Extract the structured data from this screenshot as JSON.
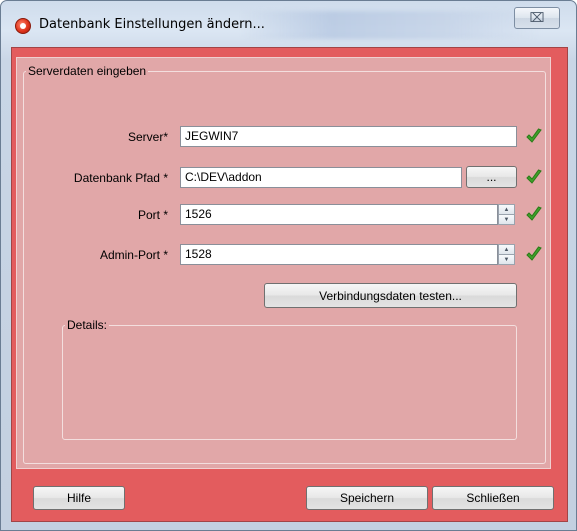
{
  "window": {
    "title": "Datenbank Einstellungen ändern...",
    "close_glyph": "⌧"
  },
  "group_server": {
    "legend": "Serverdaten eingeben"
  },
  "fields": {
    "server_label": "Server*",
    "server_value": "JEGWIN7",
    "path_label": "Datenbank Pfad *",
    "path_value": "C:\\DEV\\addon",
    "browse_label": "...",
    "port_label": "Port *",
    "port_value": "1526",
    "admin_port_label": "Admin-Port *",
    "admin_port_value": "1528"
  },
  "test_button": "Verbindungsdaten testen...",
  "group_details": {
    "legend": "Details:"
  },
  "footer": {
    "help_label": "Hilfe",
    "save_label": "Speichern",
    "close_label": "Schließen"
  },
  "colors": {
    "client_tint": "#e35c5e",
    "panel_tint": "#e1a7a8",
    "check_green": "#3fa12a"
  },
  "icons": {
    "app": "app-logo-icon",
    "valid": "check-icon",
    "spin_up": "spin-up-icon",
    "spin_down": "spin-down-icon"
  }
}
